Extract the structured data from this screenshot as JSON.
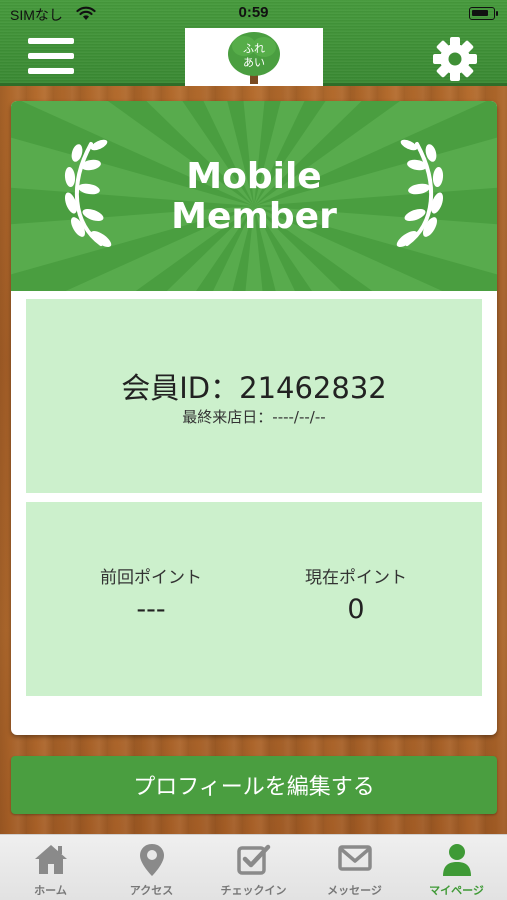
{
  "status_bar": {
    "carrier": "SIMなし",
    "time": "0:59"
  },
  "header": {
    "logo_text_top": "ふれ",
    "logo_text_bottom": "あい",
    "menu_icon": "hamburger-menu-icon",
    "settings_icon": "gear-icon"
  },
  "card": {
    "title_line1": "Mobile",
    "title_line2": "Member",
    "member_id": "会員ID：21462832",
    "last_visit": "最終来店日：----/--/--",
    "previous_points_label": "前回ポイント",
    "previous_points_value": "---",
    "current_points_label": "現在ポイント",
    "current_points_value": "0"
  },
  "edit_profile_label": "プロフィールを編集する",
  "tabs": [
    {
      "label": "ホーム",
      "icon": "home-icon"
    },
    {
      "label": "アクセス",
      "icon": "map-pin-icon"
    },
    {
      "label": "チェックイン",
      "icon": "checkbox-icon"
    },
    {
      "label": "メッセージ",
      "icon": "mail-icon"
    },
    {
      "label": "マイページ",
      "icon": "person-icon"
    }
  ],
  "active_tab": "マイページ",
  "colors": {
    "brand_green": "#4a9e40",
    "panel_green": "#ccf0cc",
    "tab_active": "#3f9a36"
  }
}
